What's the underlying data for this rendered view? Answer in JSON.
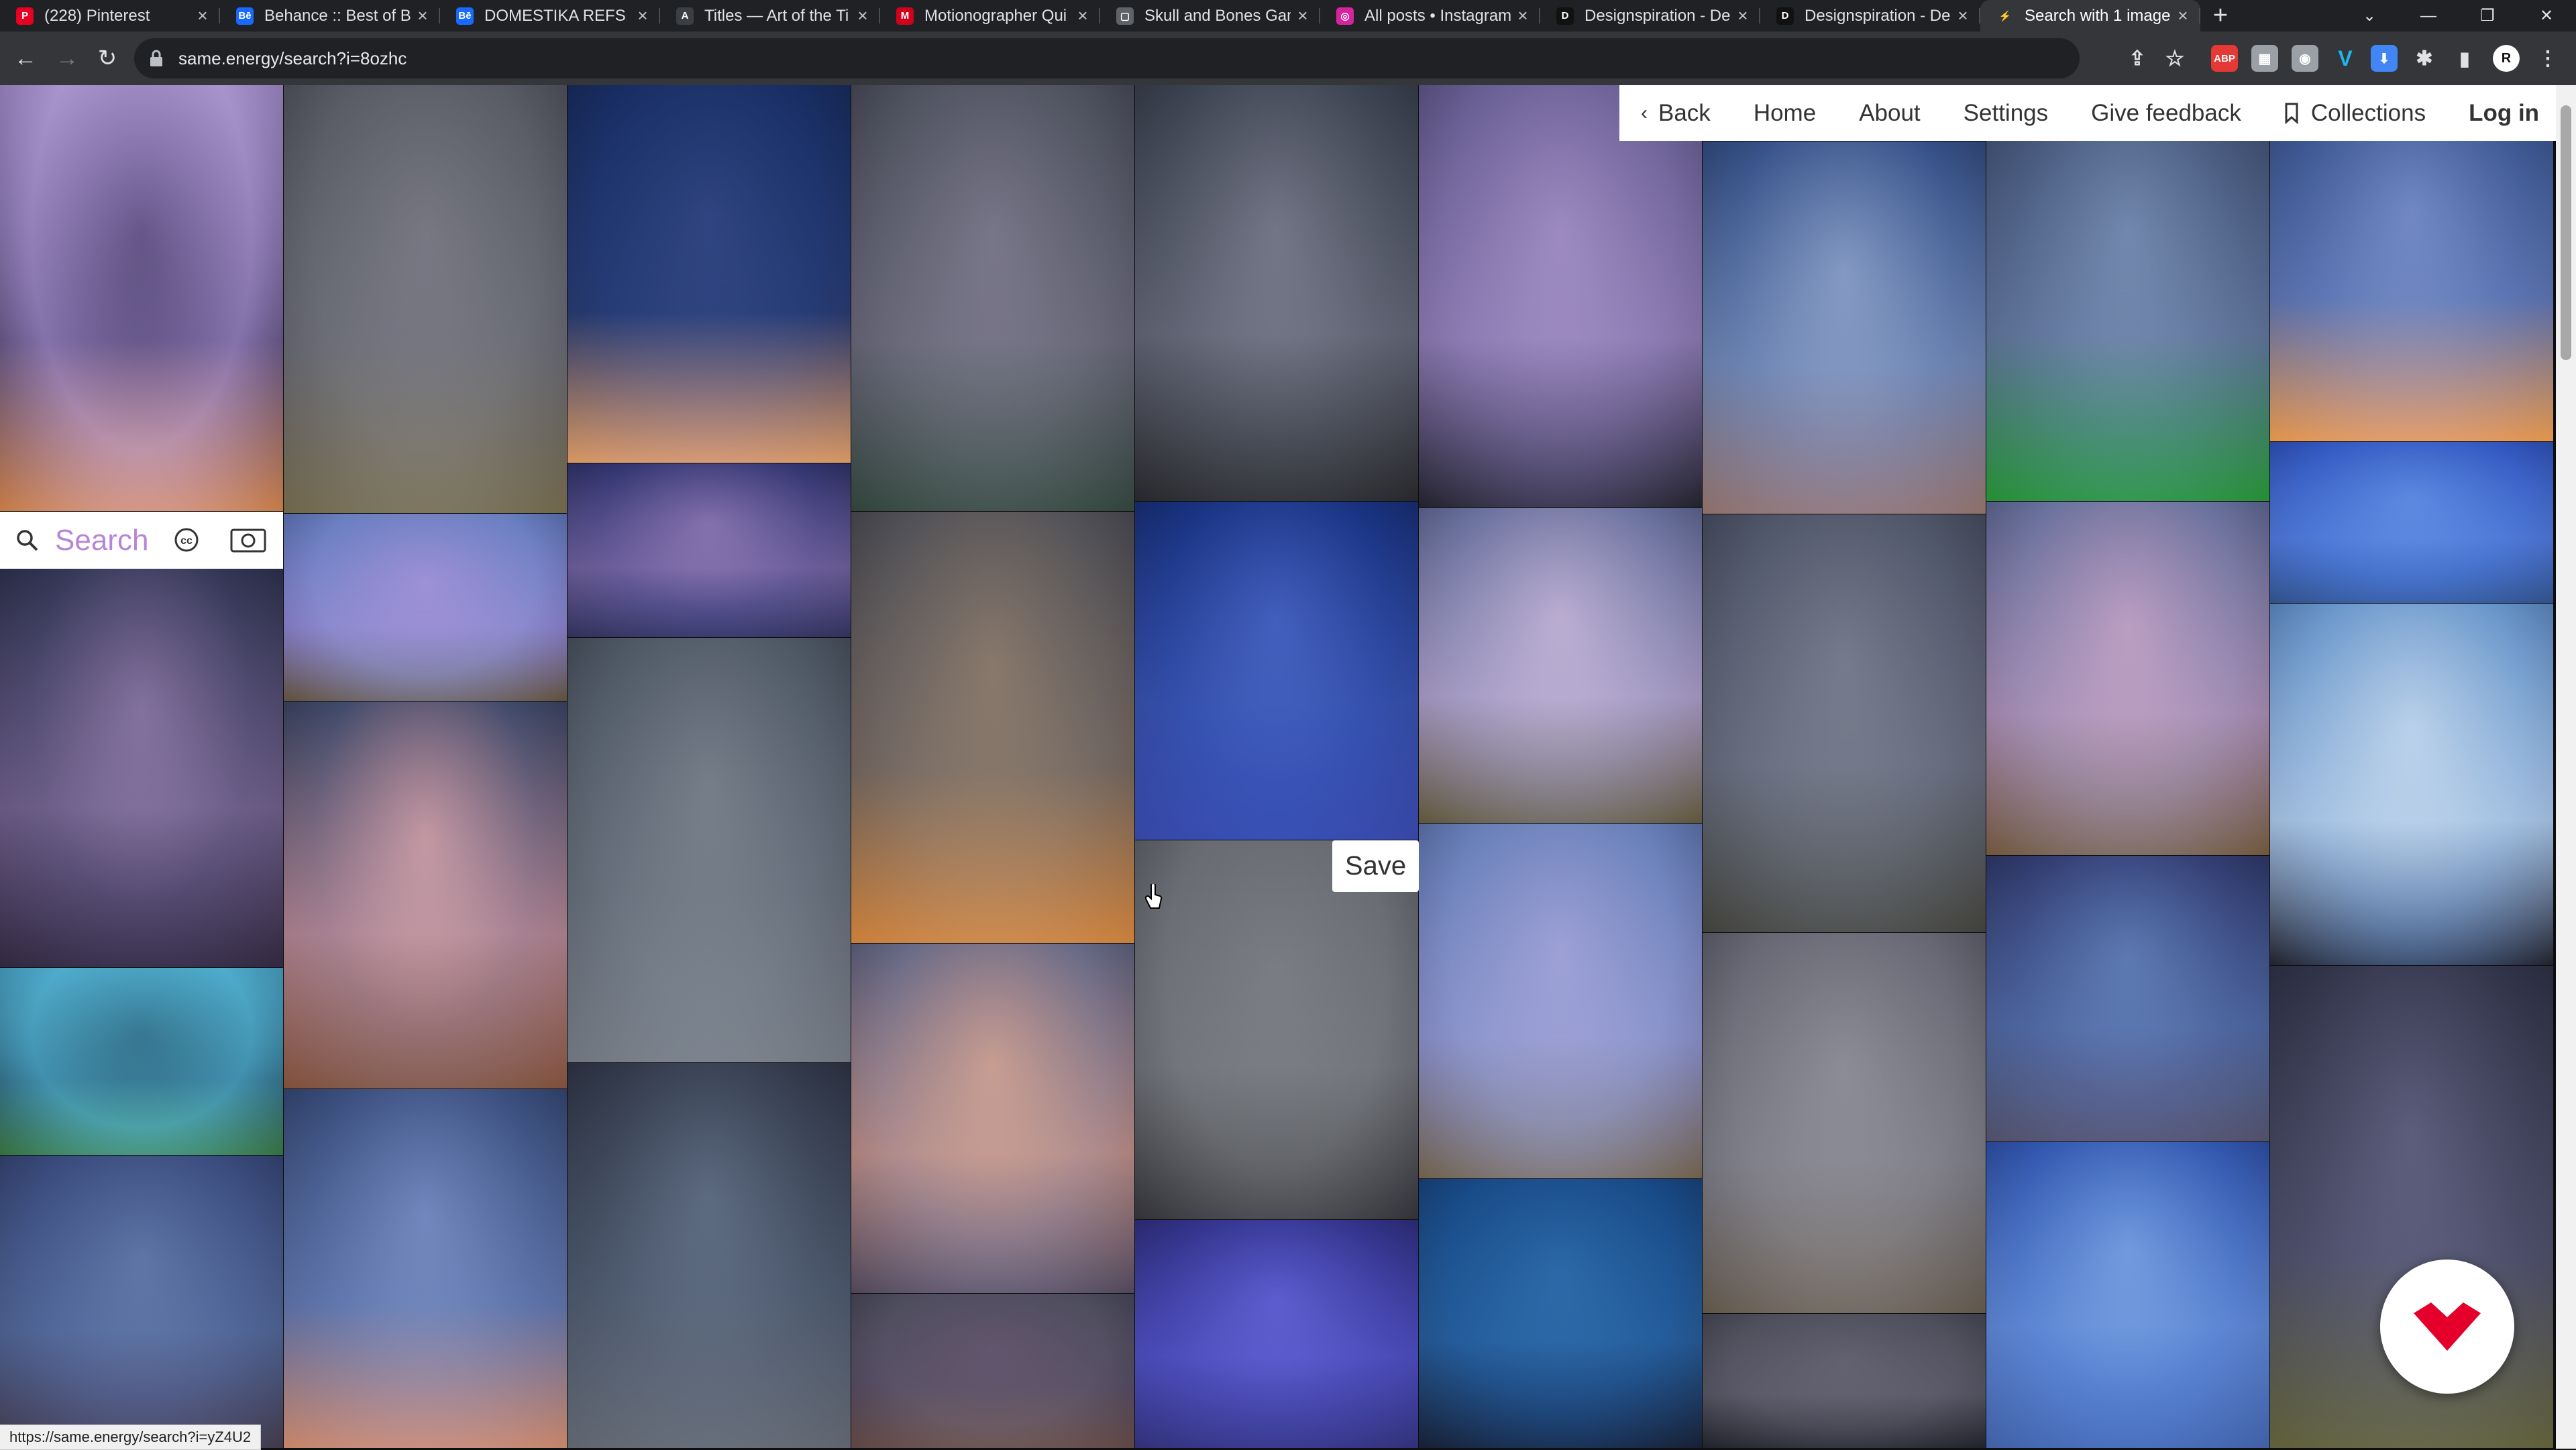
{
  "browser": {
    "tabs": [
      {
        "title": "(228) Pinterest",
        "favicon": "pinterest-icon",
        "color": "#e60023",
        "glyph": "P"
      },
      {
        "title": "Behance :: Best of Be",
        "favicon": "behance-icon",
        "color": "#1769ff",
        "glyph": "Bē"
      },
      {
        "title": "DOMESTIKA REFS",
        "favicon": "behance-icon",
        "color": "#1769ff",
        "glyph": "Bē"
      },
      {
        "title": "Titles — Art of the Ti",
        "favicon": "art-of-title-icon",
        "color": "#3b3f44",
        "glyph": "A"
      },
      {
        "title": "Motionographer Qui",
        "favicon": "motionographer-icon",
        "color": "#d0021b",
        "glyph": "M"
      },
      {
        "title": "Skull and Bones Gam",
        "favicon": "page-icon",
        "color": "#5f6368",
        "glyph": "▢"
      },
      {
        "title": "All posts • Instagram",
        "favicon": "instagram-icon",
        "color": "#d6249f",
        "glyph": "◎"
      },
      {
        "title": "Designspiration - De",
        "favicon": "designspiration-icon",
        "color": "#111111",
        "glyph": "D"
      },
      {
        "title": "Designspiration - De",
        "favicon": "designspiration-icon",
        "color": "#111111",
        "glyph": "D"
      },
      {
        "title": "Search with 1 image",
        "favicon": "same-energy-icon",
        "color": "#35363a",
        "glyph": "⚡",
        "active": true
      }
    ],
    "url": "same.energy/search?i=8ozhc",
    "status_url": "https://same.energy/search?i=yZ4U2"
  },
  "nav": {
    "back": "Back",
    "home": "Home",
    "about": "About",
    "settings": "Settings",
    "feedback": "Give feedback",
    "collections": "Collections",
    "login": "Log in"
  },
  "search": {
    "placeholder": "Search"
  },
  "hover": {
    "save": "Save"
  },
  "colors": {
    "accent": "#b885d6",
    "fab_mark": "#e4002b"
  }
}
